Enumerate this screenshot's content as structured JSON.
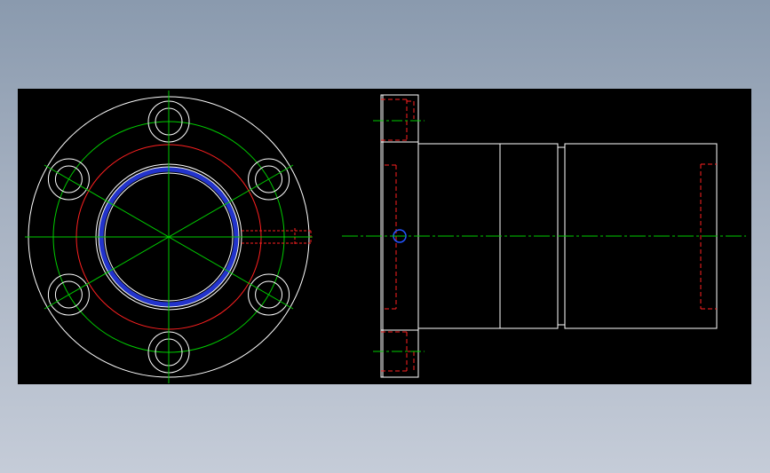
{
  "drawing": {
    "background": "#000000",
    "colors": {
      "outline": "#ffffff",
      "centerline": "#00cc00",
      "hidden": "#ff2020",
      "thread": "#2233cc",
      "hole": "#2255ff"
    },
    "front_view": {
      "bolt_hole_count": 6,
      "bolt_hole_angles_deg": [
        90,
        30,
        -30,
        -90,
        -150,
        150
      ]
    },
    "side_view": {
      "hidden_line_style": "dashed",
      "centerline_style": "dash-dot"
    }
  }
}
